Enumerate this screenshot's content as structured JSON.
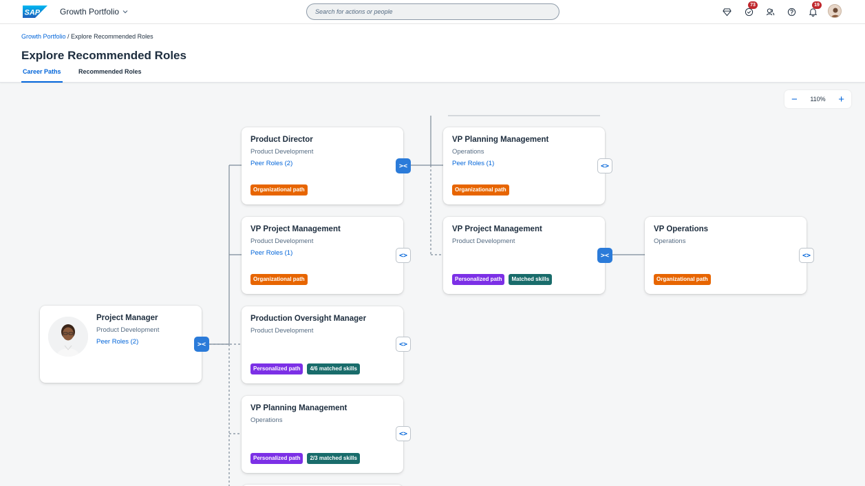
{
  "shell": {
    "logo_text": "SAP",
    "product_title": "Growth Portfolio",
    "search_placeholder": "Search for actions or people",
    "tasks_badge": "73",
    "notifications_badge": "19"
  },
  "header": {
    "breadcrumb_root": "Growth Portfolio",
    "breadcrumb_sep": " / ",
    "breadcrumb_current": "Explore Recommended Roles",
    "title": "Explore Recommended Roles",
    "tabs": [
      {
        "label": "Career Paths",
        "active": true
      },
      {
        "label": "Recommended Roles",
        "active": false
      }
    ]
  },
  "zoom": {
    "minus": "−",
    "value": "110%",
    "plus": "+"
  },
  "expand_icons": {
    "collapse": "><",
    "expand": "<>"
  },
  "current": {
    "title": "Project Manager",
    "sub": "Product Development",
    "peer": "Peer Roles (2)"
  },
  "cards": [
    {
      "title": "Product Director",
      "sub": "Product Development",
      "peer": "Peer Roles (2)",
      "tags": [
        "Organizational path"
      ]
    },
    {
      "title": "VP Project Management",
      "sub": "Product Development",
      "peer": "Peer Roles (1)",
      "tags": [
        "Organizational path"
      ]
    },
    {
      "title": "Production Oversight Manager",
      "sub": "Product Development",
      "peer": "",
      "tags": [
        "Personalized path",
        "4/6 matched skills"
      ]
    },
    {
      "title": "VP Planning Management",
      "sub": "Operations",
      "peer": "",
      "tags": [
        "Personalized path",
        "2/3 matched skills"
      ]
    },
    {
      "title": "VP Planning Management",
      "sub": "Operations",
      "peer": "Peer Roles (1)",
      "tags": [
        "Organizational path"
      ]
    },
    {
      "title": "VP Project Management",
      "sub": "Product Development",
      "peer": "",
      "tags": [
        "Personalized path",
        "Matched skills"
      ]
    },
    {
      "title": "VP Operations",
      "sub": "Operations",
      "peer": "",
      "tags": [
        "Organizational path"
      ]
    }
  ],
  "colors": {
    "accent": "#0064d9",
    "org": "#e76500",
    "personalized": "#7c30e6",
    "skills": "#196c6b"
  }
}
